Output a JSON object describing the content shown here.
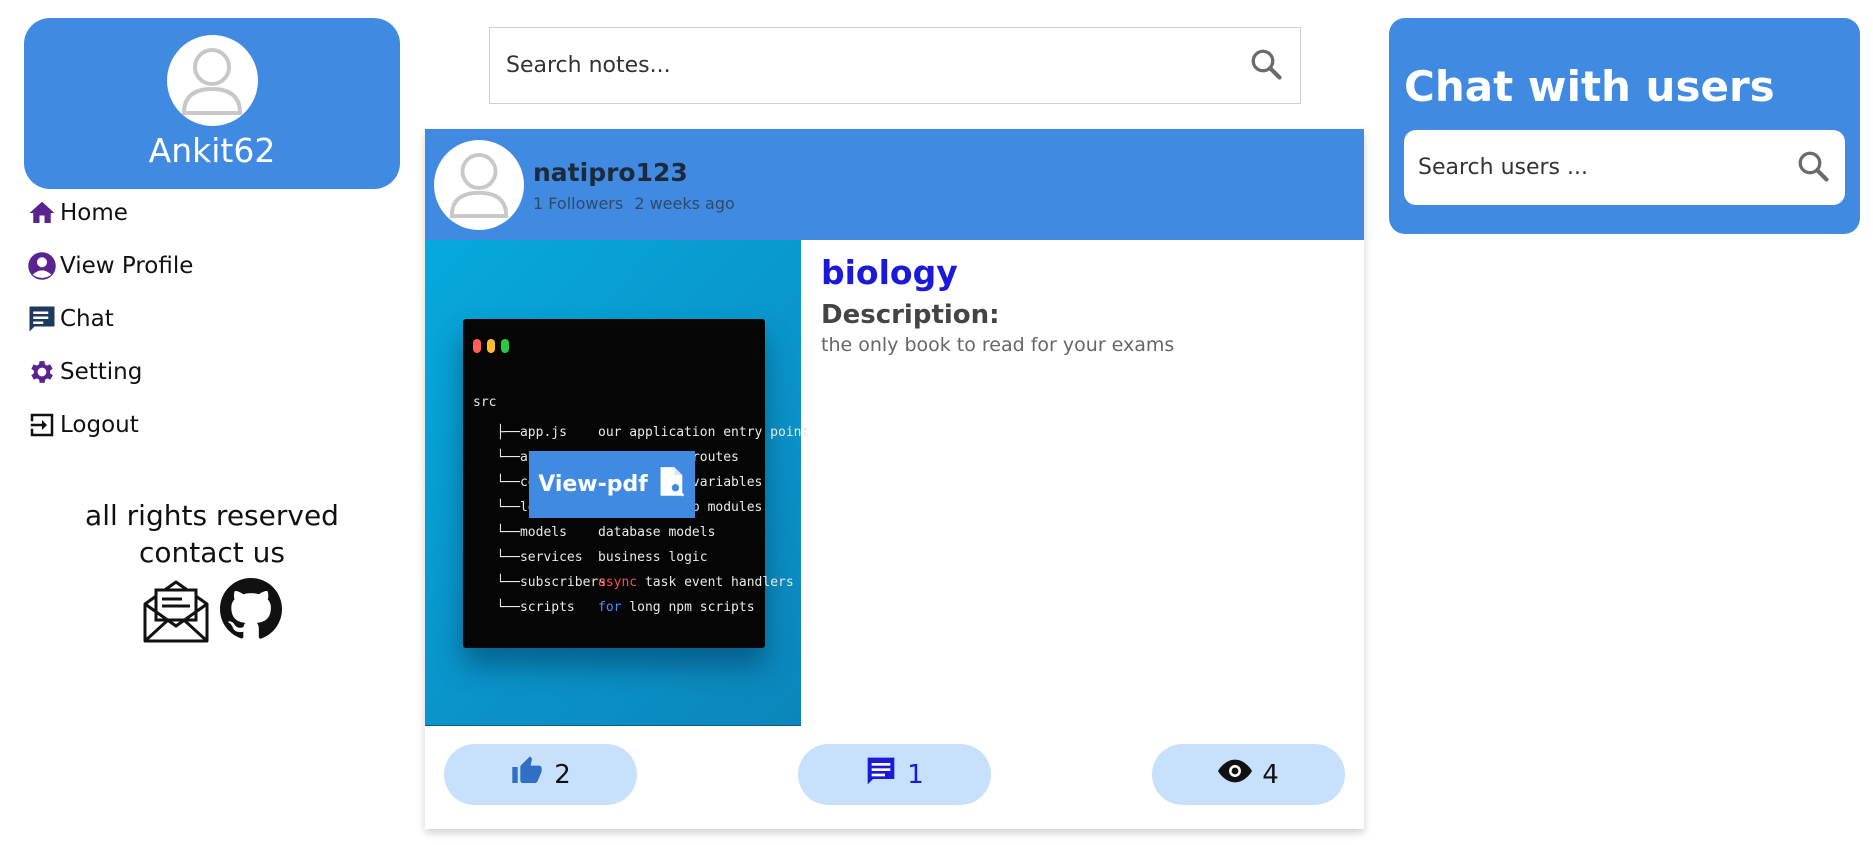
{
  "colors": {
    "accent": "#418ae2",
    "nav_icon": "#5a2490",
    "subject": "#1a1ad8",
    "pill": "#c7e0fb"
  },
  "profile": {
    "username": "Ankit62",
    "avatar_icon": "user-placeholder-icon"
  },
  "nav": {
    "items": [
      {
        "label": "Home",
        "icon": "home-icon"
      },
      {
        "label": "View Profile",
        "icon": "account-circle-icon"
      },
      {
        "label": "Chat",
        "icon": "chat-icon"
      },
      {
        "label": "Setting",
        "icon": "gear-icon"
      },
      {
        "label": "Logout",
        "icon": "logout-icon"
      }
    ]
  },
  "footer": {
    "rights": "all rights reserved",
    "contact": "contact us"
  },
  "search_notes": {
    "placeholder": "Search notes..."
  },
  "post": {
    "author": "natipro123",
    "followers": "1 Followers",
    "time": "2 weeks ago",
    "subject": "biology",
    "description_label": "Description:",
    "description": "the only book to read for your exams",
    "view_pdf_label": "View-pdf",
    "likes": "2",
    "comments": "1",
    "views": "4",
    "thumbnail": {
      "root": "src",
      "rows": [
        {
          "name": "   ├──app.js",
          "desc": "our application entry point"
        },
        {
          "name": "   └──api",
          "desc": "application routes"
        },
        {
          "name": "   └──config",
          "desc": "environment variables"
        },
        {
          "name": "   └──loaders",
          "desc": "split startup modules"
        },
        {
          "name": "   └──models",
          "desc": "database models"
        },
        {
          "name": "   └──services",
          "desc": "business logic"
        },
        {
          "name": "   └──subscribers",
          "kw": "async",
          "desc": " task event handlers"
        },
        {
          "name": "   └──scripts",
          "kw2": "for",
          "desc": " long npm scripts"
        }
      ]
    }
  },
  "chat": {
    "title": "Chat with users",
    "search_placeholder": "Search users ..."
  }
}
